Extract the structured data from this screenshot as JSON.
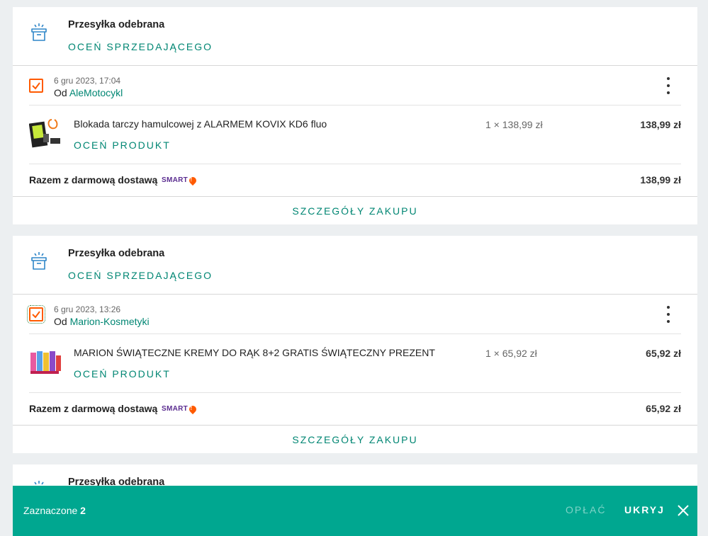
{
  "orders": [
    {
      "status_title": "Przesyłka odebrana",
      "rate_seller_label": "OCEŃ SPRZEDAJĄCEGO",
      "date": "6 gru 2023, 17:04",
      "seller_prefix": "Od",
      "seller_name": "AleMotocykl",
      "checkbox_checked": true,
      "product": {
        "name": "Blokada tarczy hamulcowej z ALARMEM KOVIX KD6 fluo",
        "rate_label": "OCEŃ PRODUKT",
        "qty_price": "1 × 138,99 zł",
        "total": "138,99 zł"
      },
      "summary_label": "Razem z darmową dostawą",
      "smart_label": "SMART",
      "summary_total": "138,99 zł",
      "details_label": "SZCZEGÓŁY ZAKUPU"
    },
    {
      "status_title": "Przesyłka odebrana",
      "rate_seller_label": "OCEŃ SPRZEDAJĄCEGO",
      "date": "6 gru 2023, 13:26",
      "seller_prefix": "Od",
      "seller_name": "Marion-Kosmetyki",
      "checkbox_checked": true,
      "product": {
        "name": "MARION ŚWIĄTECZNE KREMY DO RĄK 8+2 GRATIS ŚWIĄTECZNY PREZENT",
        "rate_label": "OCEŃ PRODUKT",
        "qty_price": "1 × 65,92 zł",
        "total": "65,92 zł"
      },
      "summary_label": "Razem z darmową dostawą",
      "smart_label": "SMART",
      "summary_total": "65,92 zł",
      "details_label": "SZCZEGÓŁY ZAKUPU"
    },
    {
      "status_title": "Przesyłka odebrana"
    }
  ],
  "selection_bar": {
    "label": "Zaznaczone",
    "count": "2",
    "pay_label": "OPŁAĆ",
    "hide_label": "UKRYJ"
  },
  "colors": {
    "accent": "#008673",
    "bar": "#00a790",
    "checkbox": "#ff5a00",
    "smart": "#5b2d90"
  }
}
